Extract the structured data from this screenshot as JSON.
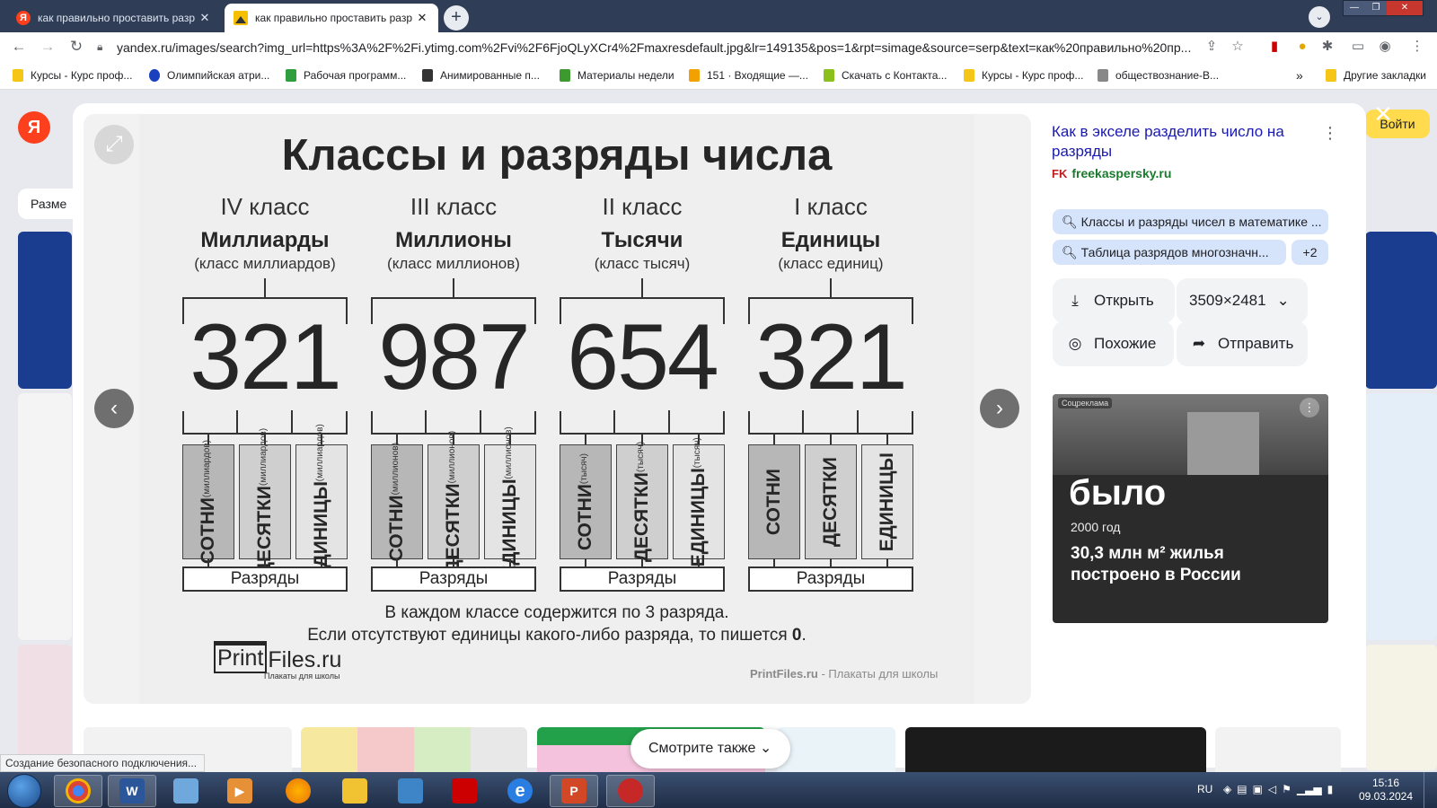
{
  "browser": {
    "tabs": [
      {
        "title": "как правильно проставить разр",
        "close": "✕"
      },
      {
        "title": "как правильно проставить разр",
        "close": "✕"
      }
    ],
    "new_tab": "+",
    "url": "yandex.ru/images/search?img_url=https%3A%2F%2Fi.ytimg.com%2Fvi%2F6FjoQLyXCr4%2Fmaxresdefault.jpg&lr=149135&pos=1&rpt=simage&source=serp&text=как%20правильно%20пр...",
    "bookmarks": [
      {
        "label": "Курсы - Курс проф...",
        "color": "#f5c518"
      },
      {
        "label": "Олимпийская атри...",
        "color": "#1a3fbf"
      },
      {
        "label": "Рабочая программ...",
        "color": "#2e9e3e"
      },
      {
        "label": "Анимированные п...",
        "color": "#333333"
      },
      {
        "label": "Материалы недели",
        "color": "#3c9a2e"
      },
      {
        "label": "151 · Входящие —...",
        "color": "#f2a100"
      },
      {
        "label": "Скачать с Контакта...",
        "color": "#8bbf1b"
      },
      {
        "label": "Курсы - Курс проф...",
        "color": "#f5c518"
      },
      {
        "label": "обществознание-В...",
        "color": "#888888"
      }
    ],
    "bookmarks_more": "»",
    "other_bookmarks": "Другие закладки"
  },
  "page": {
    "logo": "Я",
    "size_button": "Разме",
    "login_button": "Войти"
  },
  "poster": {
    "title": "Классы и разряды числа",
    "classes": [
      {
        "class_label": "IV класс",
        "name": "Миллиарды",
        "sub": "(класс миллиардов)",
        "digits": "321",
        "ranks": [
          {
            "main": "СОТНИ",
            "sub": "(миллиардов)"
          },
          {
            "main": "ДЕСЯТКИ",
            "sub": "(миллиардов)"
          },
          {
            "main": "ЕДИНИЦЫ",
            "sub": "(миллиардов)"
          }
        ]
      },
      {
        "class_label": "III класс",
        "name": "Миллионы",
        "sub": "(класс миллионов)",
        "digits": "987",
        "ranks": [
          {
            "main": "СОТНИ",
            "sub": "(миллионов)"
          },
          {
            "main": "ДЕСЯТКИ",
            "sub": "(миллионов)"
          },
          {
            "main": "ЕДИНИЦЫ",
            "sub": "(миллионов)"
          }
        ]
      },
      {
        "class_label": "II класс",
        "name": "Тысячи",
        "sub": "(класс тысяч)",
        "digits": "654",
        "ranks": [
          {
            "main": "СОТНИ",
            "sub": "(тысяч)"
          },
          {
            "main": "ДЕСЯТКИ",
            "sub": "(тысяч)"
          },
          {
            "main": "ЕДИНИЦЫ",
            "sub": "(тысяч)"
          }
        ]
      },
      {
        "class_label": "I класс",
        "name": "Единицы",
        "sub": "(класс единиц)",
        "digits": "321",
        "ranks": [
          {
            "main": "СОТНИ",
            "sub": ""
          },
          {
            "main": "ДЕСЯТКИ",
            "sub": ""
          },
          {
            "main": "ЕДИНИЦЫ",
            "sub": ""
          }
        ]
      }
    ],
    "ranks_label": "Разряды",
    "note_line1": "В каждом классе содержится по 3 разряда.",
    "note_line2_pre": "Если отсутствуют единицы какого-либо разряда, то пишется ",
    "note_line2_bold": "0",
    "note_line2_post": ".",
    "logo_print": "Print",
    "logo_files": "Files.ru",
    "logo_sub": "Плакаты для школы",
    "footer_brand": "PrintFiles.ru",
    "footer_rest": " - Плакаты для школы"
  },
  "panel": {
    "title": "Как в экселе разделить число на разряды",
    "source_icon": "FK",
    "source": "freekaspersky.ru",
    "chips": [
      "Классы и разряды чисел в математике ...",
      "Таблица разрядов многозначн...",
      "+2"
    ],
    "open_button": "Открыть",
    "size_value": "3509×2481",
    "similar_button": "Похожие",
    "share_button": "Отправить",
    "ad_label": "Соцреклама",
    "ad_big": "было",
    "ad_year": "2000 год",
    "ad_text": "30,3 млн м² жилья построено в России"
  },
  "bottom": {
    "see_also": "Смотрите также",
    "status": "Создание безопасного подключения..."
  },
  "taskbar": {
    "apps": [
      {
        "name": "chrome",
        "glyph": "",
        "color": "#db4437",
        "active": true
      },
      {
        "name": "word",
        "glyph": "W",
        "color": "#2b579a",
        "active": true
      },
      {
        "name": "notepad",
        "glyph": "",
        "color": "#6fa8dc",
        "active": false
      },
      {
        "name": "media",
        "glyph": "▶",
        "color": "#e69138",
        "active": false
      },
      {
        "name": "firefox",
        "glyph": "",
        "color": "#e8710a",
        "active": false
      },
      {
        "name": "explorer",
        "glyph": "",
        "color": "#f1c232",
        "active": false
      },
      {
        "name": "tool",
        "glyph": "",
        "color": "#3d85c6",
        "active": false
      },
      {
        "name": "acrobat",
        "glyph": "",
        "color": "#cc0000",
        "active": false
      },
      {
        "name": "ie",
        "glyph": "e",
        "color": "#2a7de1",
        "active": false
      },
      {
        "name": "powerpoint",
        "glyph": "P",
        "color": "#d24726",
        "active": true
      },
      {
        "name": "app-red",
        "glyph": "",
        "color": "#c62828",
        "active": true
      }
    ],
    "lang": "RU",
    "time": "15:16",
    "date": "09.03.2024"
  }
}
